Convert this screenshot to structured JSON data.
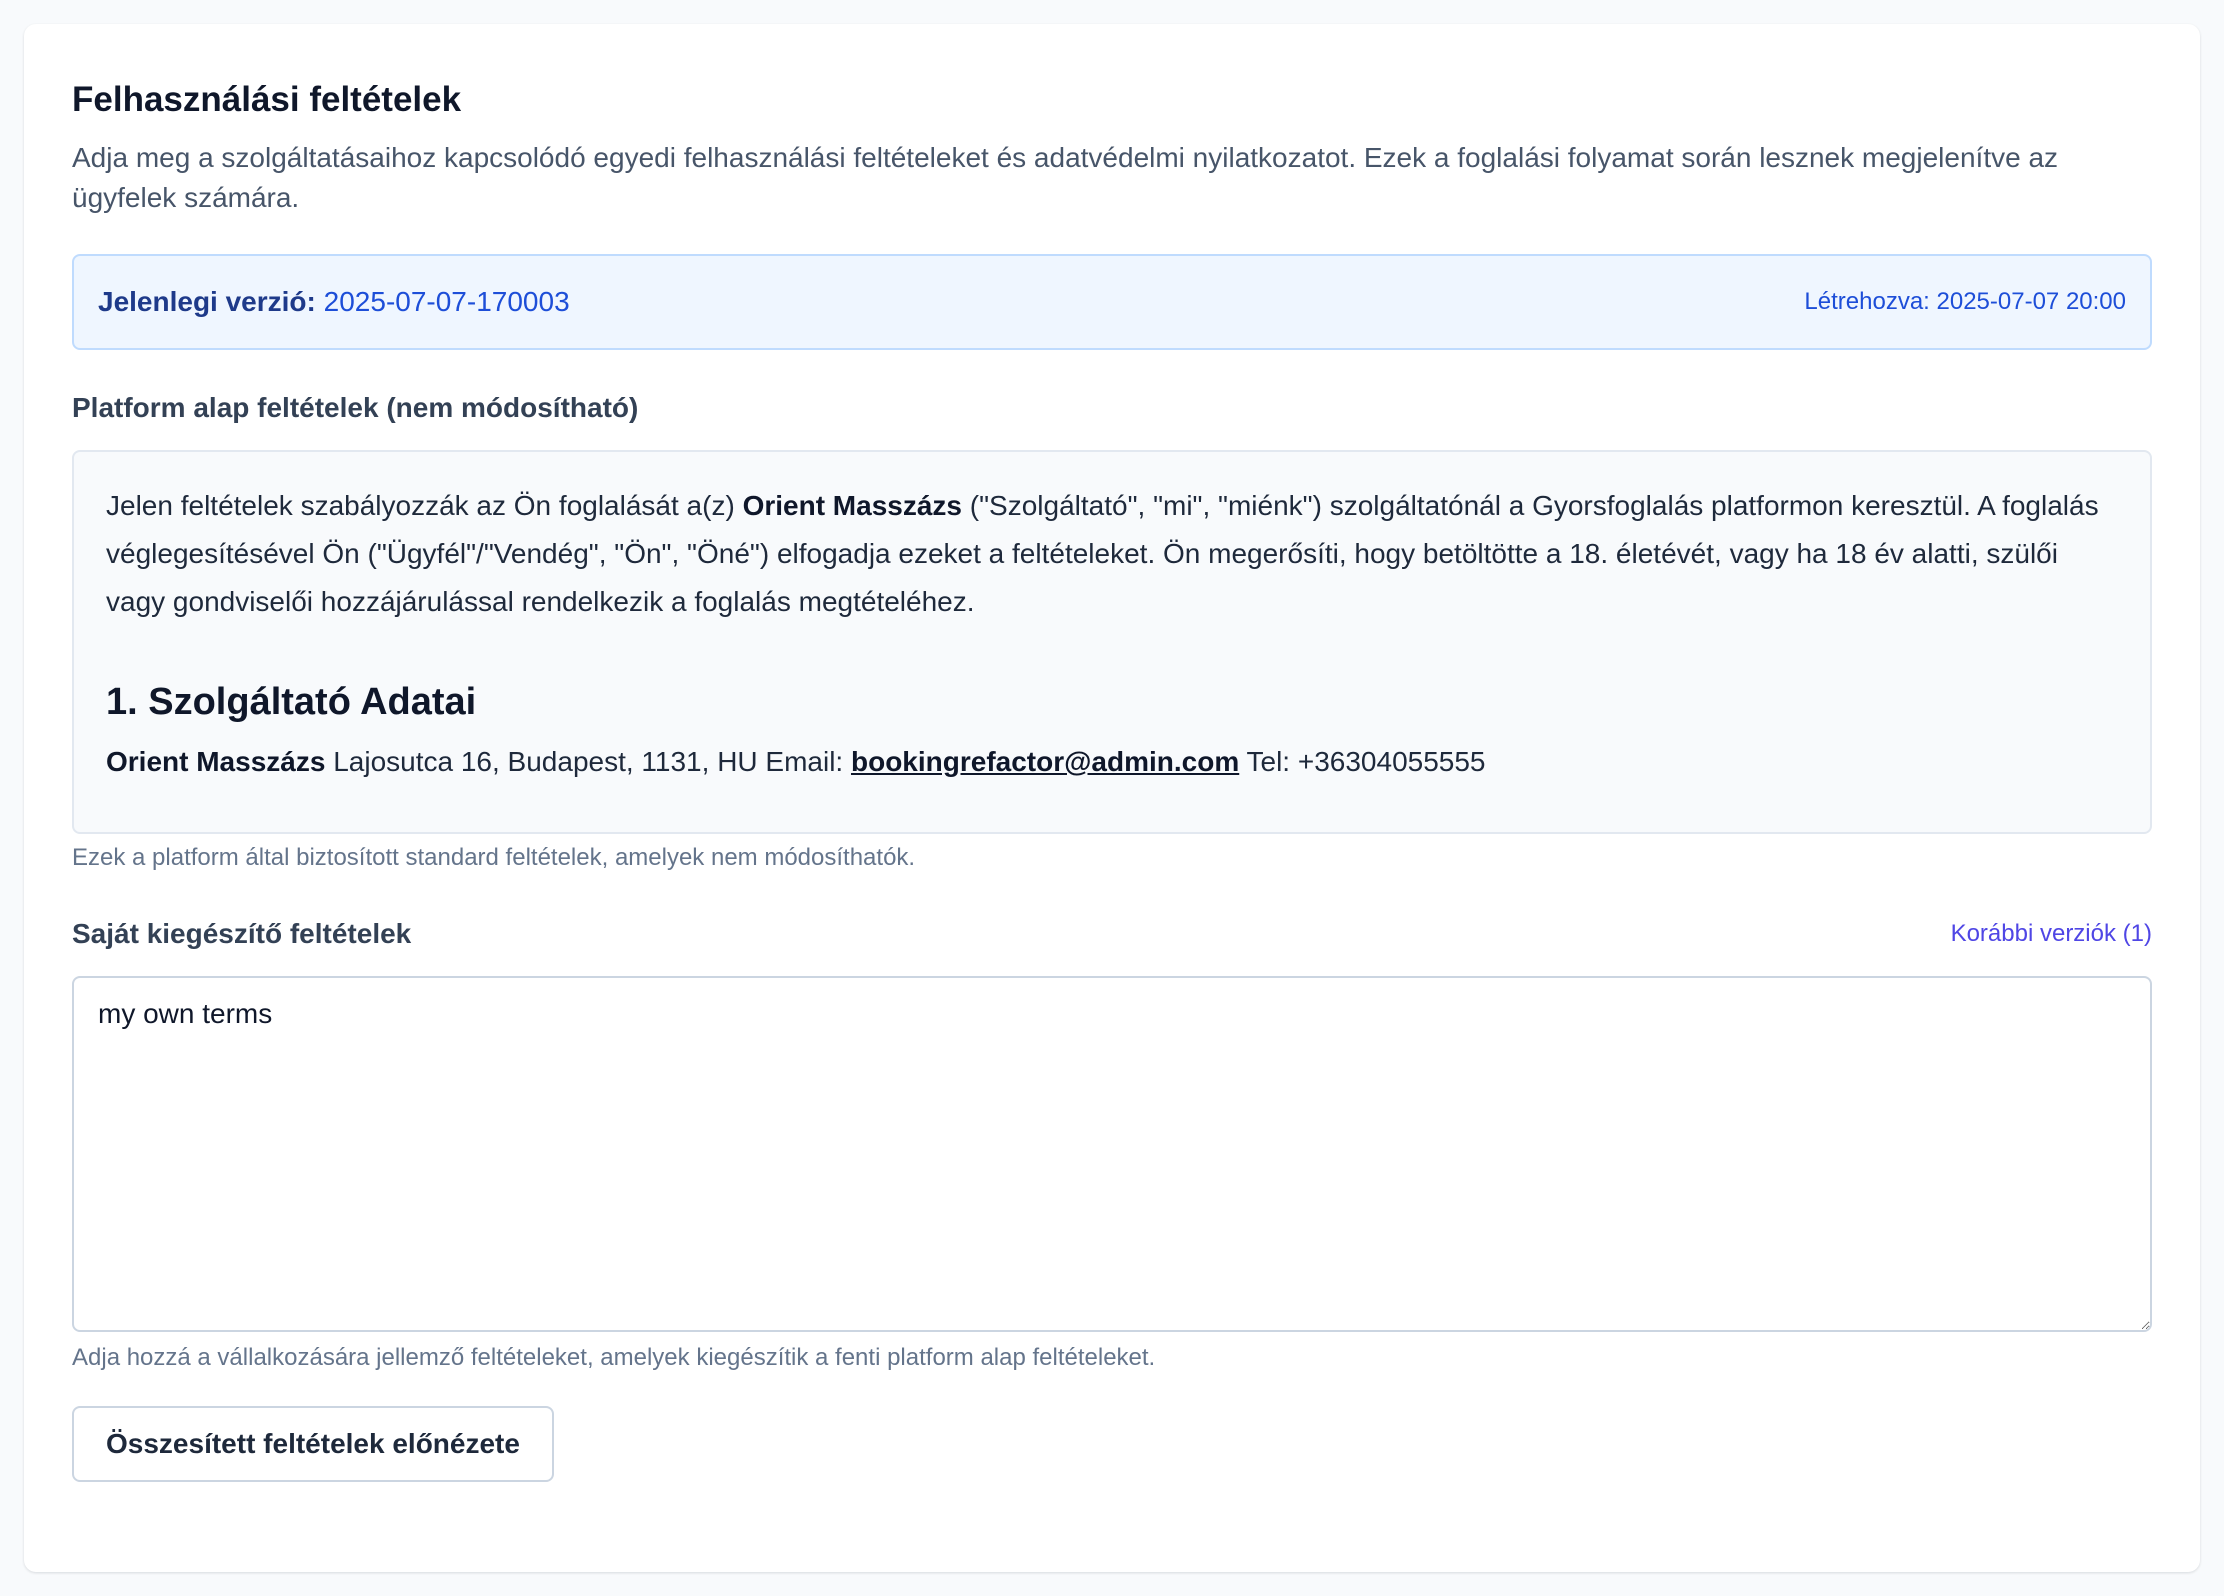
{
  "page": {
    "title": "Felhasználási feltételek",
    "description": "Adja meg a szolgáltatásaihoz kapcsolódó egyedi felhasználási feltételeket és adatvédelmi nyilatkozatot. Ezek a foglalási folyamat során lesznek megjelenítve az ügyfelek számára."
  },
  "version": {
    "label": "Jelenlegi verzió:",
    "value": "2025-07-07-170003",
    "created": "Létrehozva: 2025-07-07 20:00"
  },
  "platform_terms": {
    "label": "Platform alap feltételek (nem módosítható)",
    "intro_before": "Jelen feltételek szabályozzák az Ön foglalását a(z) ",
    "provider_name": "Orient Masszázs",
    "intro_after": " (\"Szolgáltató\", \"mi\", \"miénk\") szolgáltatónál a Gyorsfoglalás platformon keresztül. A foglalás véglegesítésével Ön (\"Ügyfél\"/\"Vendég\", \"Ön\", \"Öné\") elfogadja ezeket a feltételeket. Ön megerősíti, hogy betöltötte a 18. életévét, vagy ha 18 év alatti, szülői vagy gondviselői hozzájárulással rendelkezik a foglalás megtételéhez.",
    "section_heading": "1. Szolgáltató Adatai",
    "address_text": " Lajosutca 16, Budapest, 1131, HU Email: ",
    "email": "bookingrefactor@admin.com",
    "phone_text": " Tel: +36304055555",
    "hint": "Ezek a platform által biztosított standard feltételek, amelyek nem módosíthatók."
  },
  "own_terms": {
    "label": "Saját kiegészítő feltételek",
    "versions_link": "Korábbi verziók (1)",
    "value": "my own terms",
    "hint": "Adja hozzá a vállalkozására jellemző feltételeket, amelyek kiegészítik a fenti platform alap feltételeket."
  },
  "actions": {
    "preview_label": "Összesített feltételek előnézete"
  },
  "colors": {
    "accent_link": "#4f46e5",
    "version_bg": "#eff6ff",
    "version_text": "#1d4ed8"
  }
}
